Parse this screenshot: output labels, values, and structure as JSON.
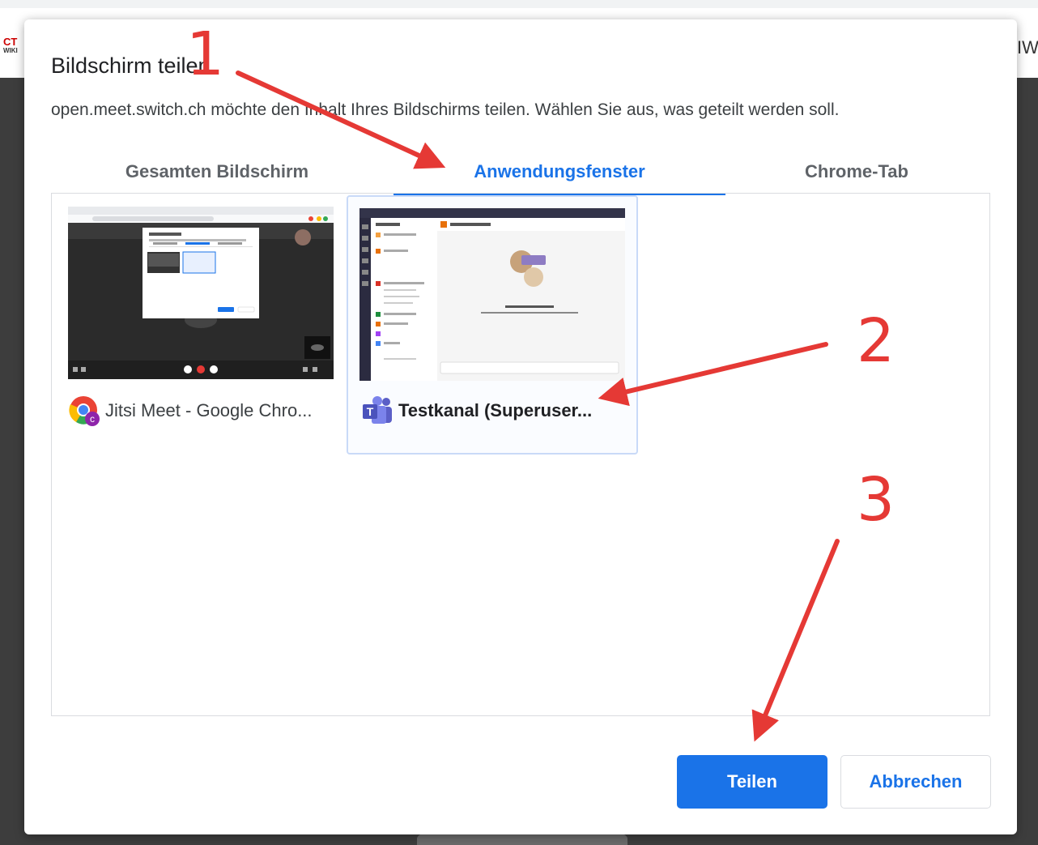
{
  "background": {
    "logo_top": "CT",
    "logo_bottom": "WIKI",
    "right_text": "IW"
  },
  "dialog": {
    "title": "Bildschirm teilen",
    "description": "open.meet.switch.ch möchte den Inhalt Ihres Bildschirms teilen. Wählen Sie aus, was geteilt werden soll.",
    "tabs": [
      {
        "label": "Gesamten Bildschirm",
        "selected": false
      },
      {
        "label": "Anwendungsfenster",
        "selected": true
      },
      {
        "label": "Chrome-Tab",
        "selected": false
      }
    ],
    "sources": [
      {
        "label": "Jitsi Meet - Google Chro...",
        "icon": "chrome-icon",
        "selected": false
      },
      {
        "label": "Testkanal (Superuser...",
        "icon": "teams-icon",
        "selected": true
      }
    ],
    "share_label": "Teilen",
    "cancel_label": "Abbrechen"
  },
  "annotations": {
    "step1": "1",
    "step2": "2",
    "step3": "3"
  },
  "colors": {
    "accent": "#1a73e8",
    "annotation": "#e53935"
  }
}
